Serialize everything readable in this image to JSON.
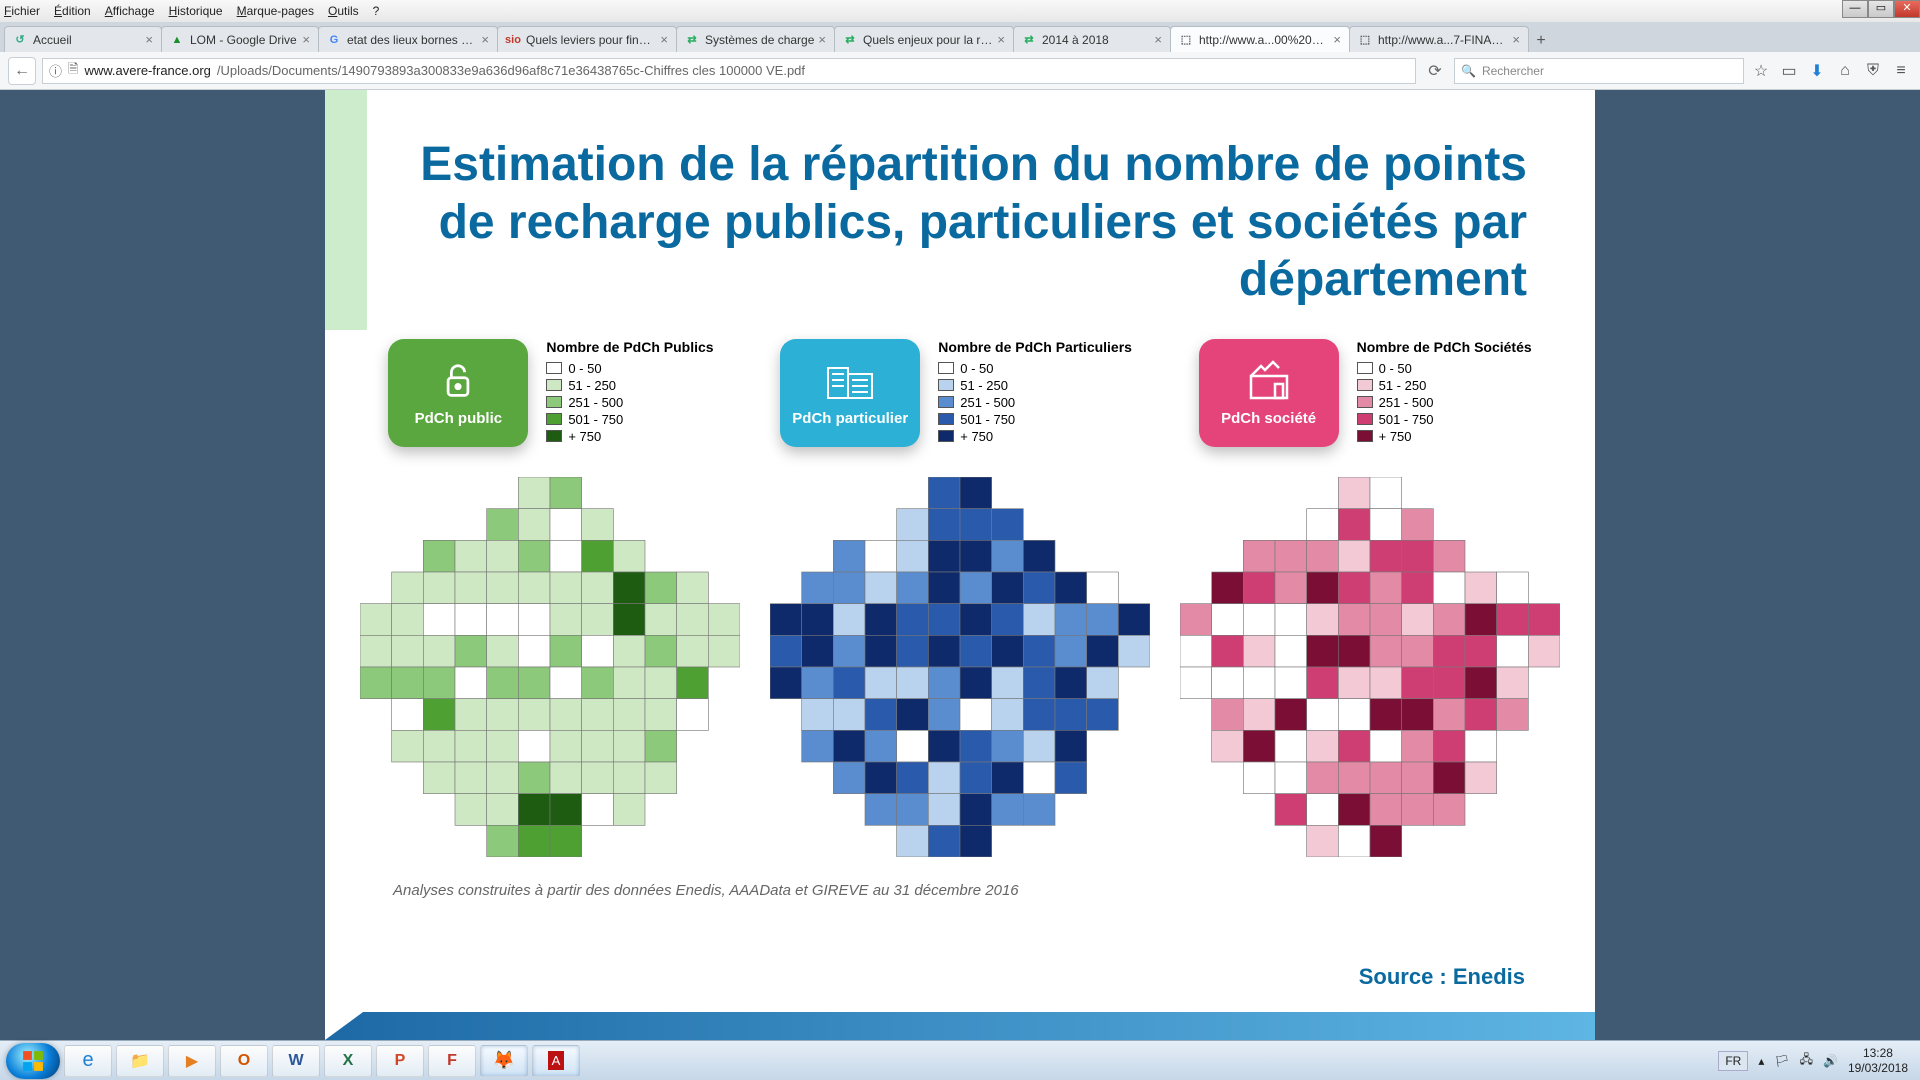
{
  "menu": [
    "Fichier",
    "Édition",
    "Affichage",
    "Historique",
    "Marque-pages",
    "Outils",
    "?"
  ],
  "tabs": [
    {
      "fav": "↺",
      "color": "#3a8",
      "label": "Accueil"
    },
    {
      "fav": "▲",
      "color": "#1a8f2c",
      "label": "LOM - Google Drive"
    },
    {
      "fav": "G",
      "color": "#4285f4",
      "label": "etat des lieux bornes de re..."
    },
    {
      "fav": "sio",
      "color": "#c0392b",
      "label": "Quels leviers pour finance..."
    },
    {
      "fav": "⇄",
      "color": "#27ae60",
      "label": "Systèmes de charge"
    },
    {
      "fav": "⇄",
      "color": "#27ae60",
      "label": "Quels enjeux pour la recha..."
    },
    {
      "fav": "⇄",
      "color": "#27ae60",
      "label": "2014 à 2018"
    },
    {
      "fav": "⬚",
      "color": "#555",
      "label": "http://www.a...00%20VE.pdf",
      "active": true
    },
    {
      "fav": "⬚",
      "color": "#555",
      "label": "http://www.a...7-FINAL.pdf"
    }
  ],
  "url": {
    "info_icon": "ⓘ",
    "domain": "www.avere-france.org",
    "path": "/Uploads/Documents/1490793893a300833e9a636d96af8c71e36438765c-Chiffres cles 100000 VE.pdf"
  },
  "search_placeholder": "Rechercher",
  "doc": {
    "title": "Estimation de la répartition du nombre de points de recharge publics, particuliers et sociétés par département",
    "footer": "Analyses construites à partir des données Enedis, AAAData et GIREVE  au 31 décembre 2016",
    "source": "Source : Enedis",
    "legends": [
      {
        "badge": "PdCh public",
        "title": "Nombre de PdCh Publics",
        "scheme": "green"
      },
      {
        "badge": "PdCh particulier",
        "title": "Nombre de PdCh Particuliers",
        "scheme": "blue"
      },
      {
        "badge": "PdCh société",
        "title": "Nombre de PdCh Sociétés",
        "scheme": "pink"
      }
    ],
    "ranges": [
      "0 - 50",
      "51 - 250",
      "251 - 500",
      "501 - 750",
      "+ 750"
    ]
  },
  "swatches": {
    "green": [
      "#ffffff",
      "#cfe8c4",
      "#8cc97a",
      "#4ea033",
      "#1e5c11"
    ],
    "blue": [
      "#ffffff",
      "#b9d3ef",
      "#5a8cd0",
      "#2a5aac",
      "#0e2a6b"
    ],
    "pink": [
      "#ffffff",
      "#f3c9d6",
      "#e38aa6",
      "#cf3e72",
      "#7a0e34"
    ]
  },
  "tray": {
    "lang": "FR",
    "time": "13:28",
    "date": "19/03/2018"
  }
}
